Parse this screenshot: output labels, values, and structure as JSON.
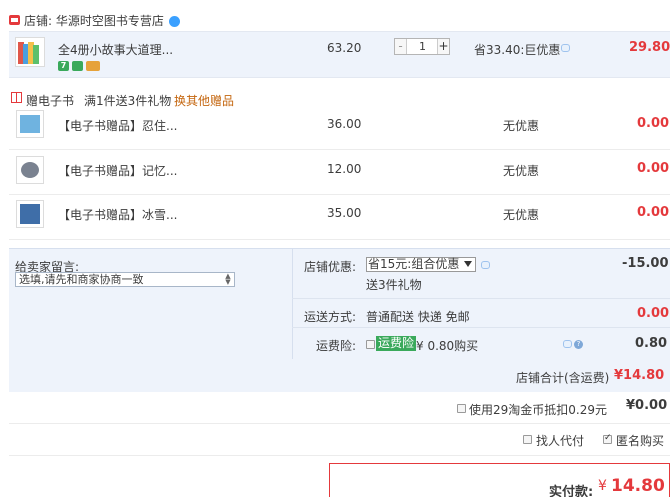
{
  "shop": {
    "label": "店铺: 华源时空图书专营店",
    "icon": "shop-icon",
    "chat_icon": "wangwang-icon"
  },
  "main_item": {
    "title": "全4册小故事大道理...",
    "price": "63.20",
    "quantity": "1",
    "discount": "省33.40:巨优惠",
    "subtotal": "29.80",
    "badges": [
      "7-day-return-icon",
      "guarantee-icon",
      "credit-card-icon"
    ],
    "badge_text_7": "7"
  },
  "gift": {
    "label": "赠电子书",
    "rule": "满1件送3件礼物",
    "change_link": "换其他赠品",
    "items": [
      {
        "title": "【电子书赠品】忍住...",
        "price": "36.00",
        "discount": "无优惠",
        "subtotal": "0.00"
      },
      {
        "title": "【电子书赠品】记忆...",
        "price": "12.00",
        "discount": "无优惠",
        "subtotal": "0.00"
      },
      {
        "title": "【电子书赠品】冰雪...",
        "price": "35.00",
        "discount": "无优惠",
        "subtotal": "0.00"
      }
    ]
  },
  "message": {
    "label": "给卖家留言:",
    "value": "选填,请先和商家协商一致"
  },
  "shop_discount": {
    "label": "店铺优惠:",
    "selected": "省15元:组合优惠",
    "note": "送3件礼物",
    "amount": "-15.00"
  },
  "shipping": {
    "label": "运送方式:",
    "value": "普通配送 快递 免邮",
    "amount": "0.00"
  },
  "insurance": {
    "label": "运费险:",
    "tag": "运费险",
    "desc": "¥ 0.80购买",
    "amount": "0.80"
  },
  "shop_total": {
    "label": "店铺合计(含运费)",
    "amount": "¥14.80"
  },
  "taojinbi": {
    "label": "使用29淘金币抵扣0.29元",
    "amount": "¥0.00"
  },
  "options": {
    "proxy_pay": "找人代付",
    "anonymous": "匿名购买"
  },
  "payment": {
    "label": "实付款:",
    "currency": "¥",
    "amount": "14.80"
  },
  "colors": {
    "accent_red": "#e4393c",
    "panel_bg": "#eef3fb",
    "link_orange": "#c4660f",
    "insurance_green": "#3aa95b"
  }
}
